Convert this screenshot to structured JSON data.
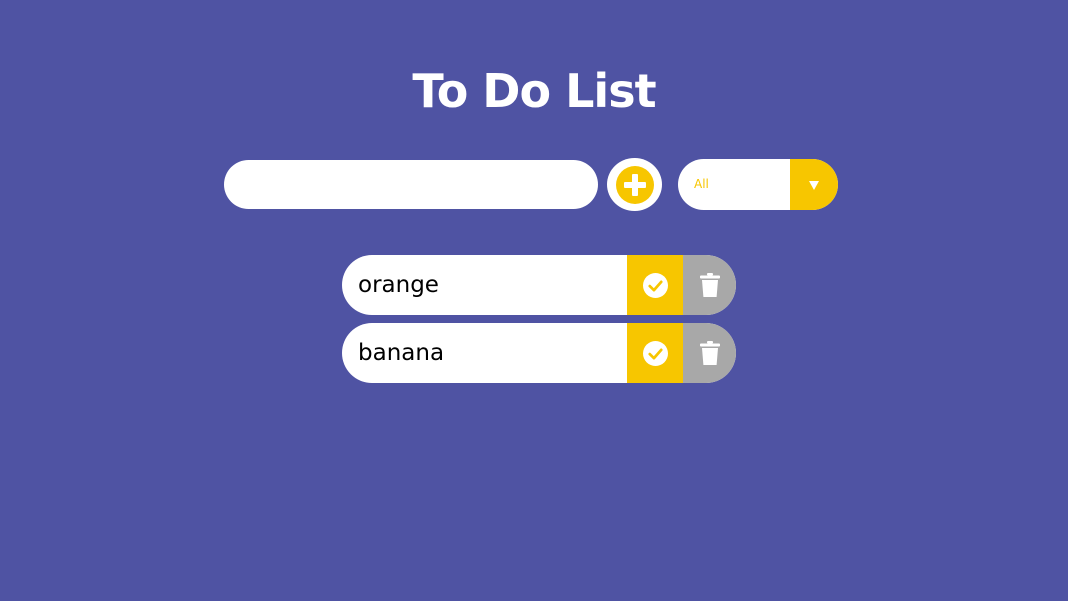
{
  "header": {
    "title": "To Do List"
  },
  "form": {
    "input_value": "",
    "add_icon": "plus-circle-icon",
    "filter": {
      "selected": "All",
      "arrow_icon": "caret-down-icon"
    }
  },
  "todos": [
    {
      "text": "orange",
      "complete_icon": "check-circle-icon",
      "delete_icon": "trash-icon"
    },
    {
      "text": "banana",
      "complete_icon": "check-circle-icon",
      "delete_icon": "trash-icon"
    }
  ],
  "colors": {
    "background": "#4f53a3",
    "accent": "#f7c600",
    "delete": "#a8a8a8",
    "surface": "#ffffff"
  }
}
